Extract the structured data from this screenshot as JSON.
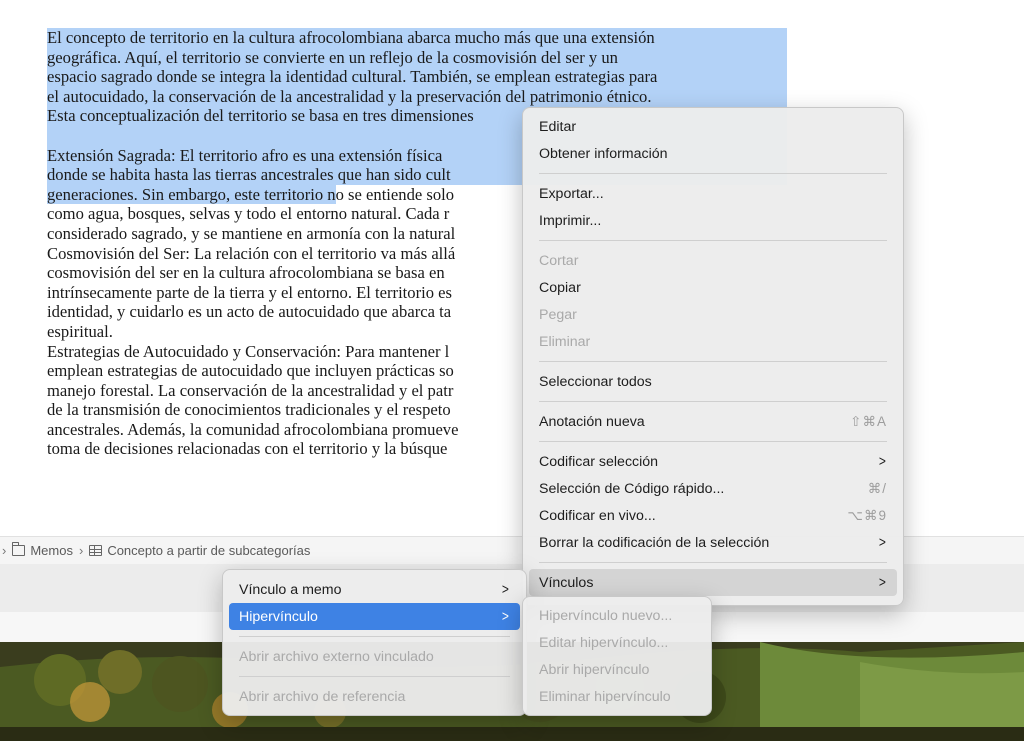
{
  "document": {
    "para1": [
      "El concepto de territorio en la cultura afrocolombiana abarca mucho más que una extensión",
      "geográfica. Aquí, el territorio se convierte en un reflejo de la cosmovisión del ser y un",
      "espacio sagrado donde se integra la identidad cultural. También, se emplean estrategias para",
      "el autocuidado, la conservación de la ancestralidad y la preservación del patrimonio étnico.",
      "Esta conceptualización del territorio se basa en tres dimensiones"
    ],
    "para2_highlighted": [
      "Extensión Sagrada: El territorio afro es una extensión física",
      "donde se habita hasta las tierras ancestrales que han sido cult"
    ],
    "para2_mixed_hl": "generaciones. Sin embargo, este territorio n",
    "para2_mixed_rest": "o se entiende solo",
    "para3": [
      "como agua, bosques, selvas y todo el entorno natural. Cada r",
      "considerado sagrado, y se mantiene en armonía con la natural",
      "Cosmovisión del Ser: La relación con el territorio va más allá",
      "cosmovisión del ser en la cultura afrocolombiana se basa en",
      "intrínsecamente parte de la tierra y el entorno. El territorio es",
      "identidad, y cuidarlo es un acto de autocuidado que abarca ta",
      "espiritual.",
      "Estrategias de Autocuidado y Conservación: Para mantener l",
      "emplean estrategias de autocuidado que incluyen prácticas so",
      "manejo forestal. La conservación de la ancestralidad y el patr",
      "de la transmisión de conocimientos tradicionales y el respeto",
      "ancestrales. Además, la comunidad afrocolombiana promueve",
      "toma de decisiones relacionadas con el territorio y la búsque"
    ]
  },
  "breadcrumb": {
    "lead": "›",
    "item1": "Memos",
    "sep": "›",
    "item2": "Concepto a partir de subcategorías"
  },
  "context_menu": {
    "editar": "Editar",
    "obtener_info": "Obtener información",
    "exportar": "Exportar...",
    "imprimir": "Imprimir...",
    "cortar": "Cortar",
    "copiar": "Copiar",
    "pegar": "Pegar",
    "eliminar": "Eliminar",
    "seleccionar_todos": "Seleccionar todos",
    "anotacion_nueva": "Anotación nueva",
    "anotacion_shortcut": "⇧⌘A",
    "codificar_seleccion": "Codificar selección",
    "codigo_rapido": "Selección de Código rápido...",
    "codigo_rapido_shortcut": "⌘/",
    "codificar_en_vivo": "Codificar en vivo...",
    "codificar_en_vivo_shortcut": "⌥⌘9",
    "borrar_codificacion": "Borrar la codificación de la selección",
    "vinculos": "Vínculos"
  },
  "vinculos_menu": {
    "vinculo_a_memo": "Vínculo a memo",
    "hipervinculo": "Hipervínculo",
    "abrir_externo": "Abrir archivo externo vinculado",
    "abrir_referencia": "Abrir archivo de referencia"
  },
  "hipervinculo_menu": {
    "nuevo": "Hipervínculo nuevo...",
    "editar": "Editar hipervínculo...",
    "abrir": "Abrir hipervínculo",
    "eliminar": "Eliminar hipervínculo"
  },
  "colors": {
    "selection_highlight": "#b3d2f7",
    "menu_active": "#3e82e4"
  },
  "icons": [
    "folder-icon",
    "table-icon",
    "chevron-right-icon"
  ]
}
